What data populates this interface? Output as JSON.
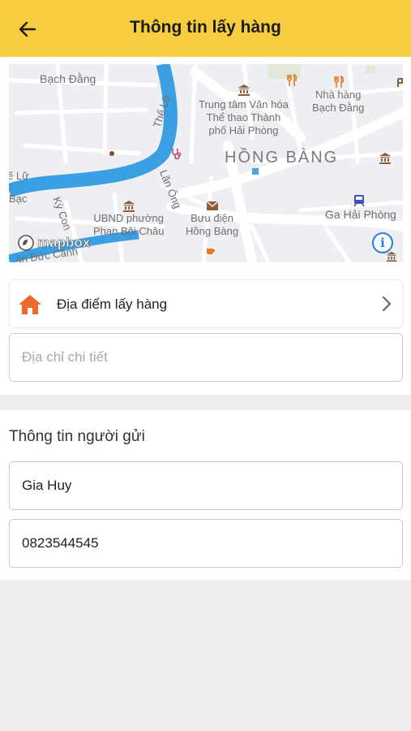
{
  "header": {
    "title": "Thông tin lấy hàng",
    "back_icon": "arrow-left-icon"
  },
  "map": {
    "labels": {
      "bach_dang": "Bạch Đằng",
      "the_lu": "Thế Lữ",
      "trung_tam": "Trung tâm Văn hóa\nThể thao Thành\nphố Hải Phòng",
      "nha_hang": "Nhà hàng\nBạch Đằng",
      "hong_bang_district": "HỒNG BÀNG",
      "lan_ong": "Lãn Ông",
      "ky_con": "Kỳ Con",
      "ubnd": "UBND phường\nPhan Bội Châu",
      "buu_dien": "Bưu điện\nHồng Bàng",
      "ga_hai_phong": "Ga Hải Phòng",
      "lu": "ế Lữ",
      "bac": "Bạc",
      "duc_canh": "ần Đức Cảnh"
    },
    "attribution": "mapbox",
    "colors": {
      "river": "#3a9fe3",
      "road": "#ffffff",
      "land": "#eeeff2",
      "poi": "#8b5e3c",
      "restaurant": "#e07b2a"
    }
  },
  "pickup": {
    "label": "Địa điểm lấy hàng",
    "icon": "home-icon",
    "icon_color": "#ef6a2a"
  },
  "address_detail": {
    "placeholder": "Địa chỉ chi tiết",
    "value": ""
  },
  "sender": {
    "title": "Thông tin người gửi",
    "name": "Gia Huy",
    "phone": "0823544545"
  },
  "colors": {
    "header_bg": "#f7cd3f",
    "page_bg": "#efefef"
  }
}
